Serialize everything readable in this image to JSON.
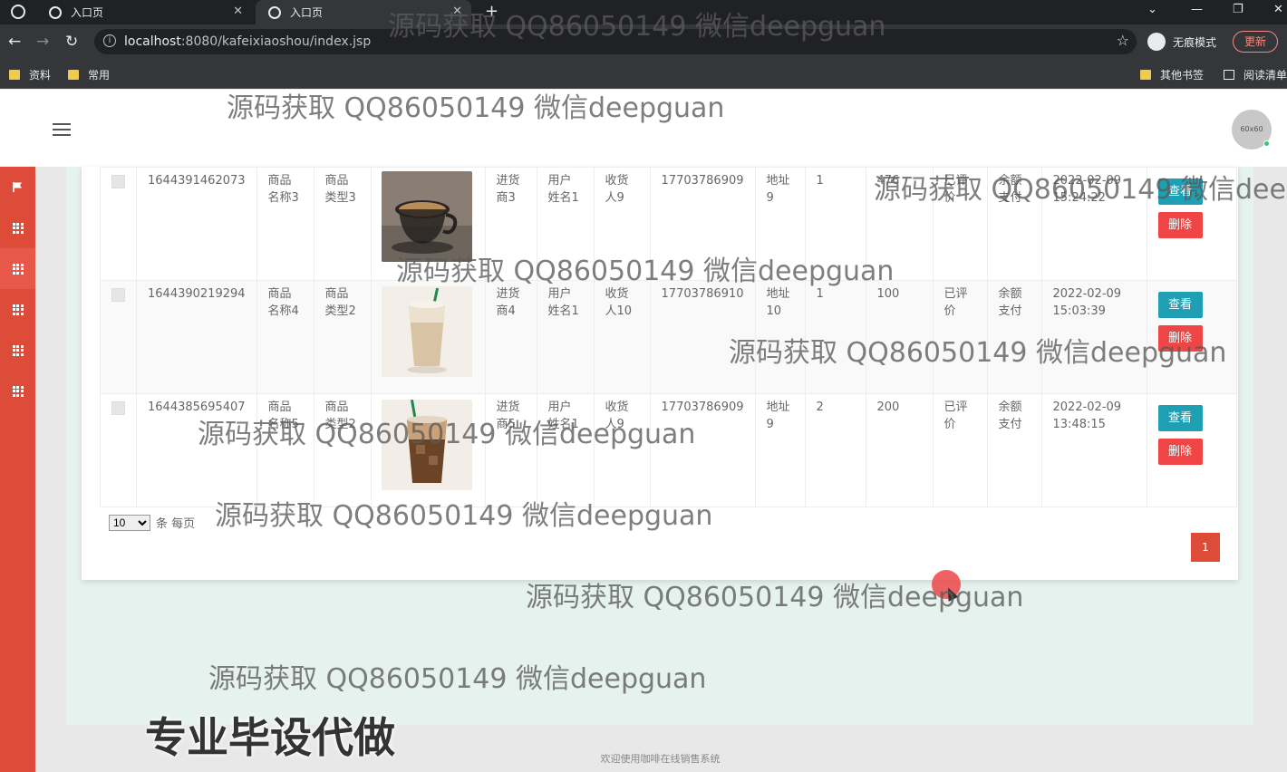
{
  "browser": {
    "tabs": [
      {
        "title": "入口页",
        "active": false
      },
      {
        "title": "入口页",
        "active": true
      }
    ],
    "url_host": "localhost",
    "url_path": ":8080/kafeixiaoshou/index.jsp",
    "incognito_label": "无痕模式",
    "update_label": "更新",
    "bookmarks": [
      "资料",
      "常用"
    ],
    "bookmarks_right": [
      "其他书签",
      "阅读清单"
    ]
  },
  "header": {
    "avatar_text": "60x60"
  },
  "sidebar": {
    "accent_color": "#dd4b39",
    "icons": [
      "flag-icon",
      "grid-icon",
      "grid-icon",
      "grid-icon",
      "grid-icon",
      "grid-icon"
    ]
  },
  "table": {
    "rows": [
      {
        "order_no": "1644391462073",
        "product_name": "商品\n名称3",
        "product_type": "商品\n类型3",
        "image": "espresso-cup",
        "supplier": "进货\n商3",
        "user_name": "用户\n姓名1",
        "receiver": "收货\n人9",
        "phone": "17703786909",
        "address": "地址\n9",
        "quantity": "1",
        "amount": "476",
        "review_status": "已评\n价",
        "pay_method": "余额\n支付",
        "time": "2022-02-09\n15:24:22"
      },
      {
        "order_no": "1644390219294",
        "product_name": "商品\n名称4",
        "product_type": "商品\n类型2",
        "image": "latte-cup",
        "supplier": "进货\n商4",
        "user_name": "用户\n姓名1",
        "receiver": "收货\n人10",
        "phone": "17703786910",
        "address": "地址\n10",
        "quantity": "1",
        "amount": "100",
        "review_status": "已评\n价",
        "pay_method": "余额\n支付",
        "time": "2022-02-09\n15:03:39"
      },
      {
        "order_no": "1644385695407",
        "product_name": "商品\n名称5",
        "product_type": "商品\n类型2",
        "image": "iced-coffee-cup",
        "supplier": "进货\n商5",
        "user_name": "用户\n姓名1",
        "receiver": "收货\n人9",
        "phone": "17703786909",
        "address": "地址\n9",
        "quantity": "2",
        "amount": "200",
        "review_status": "已评\n价",
        "pay_method": "余额\n支付",
        "time": "2022-02-09\n13:48:15"
      }
    ],
    "view_label": "查看",
    "delete_label": "删除"
  },
  "pagination": {
    "page_size": "10",
    "page_size_suffix": "条 每页",
    "current_page": "1"
  },
  "footer": {
    "text": "欢迎使用咖啡在线销售系统"
  },
  "overlays": {
    "watermark": "源码获取 QQ86050149 微信deepguan",
    "banner": "专业毕设代做"
  }
}
